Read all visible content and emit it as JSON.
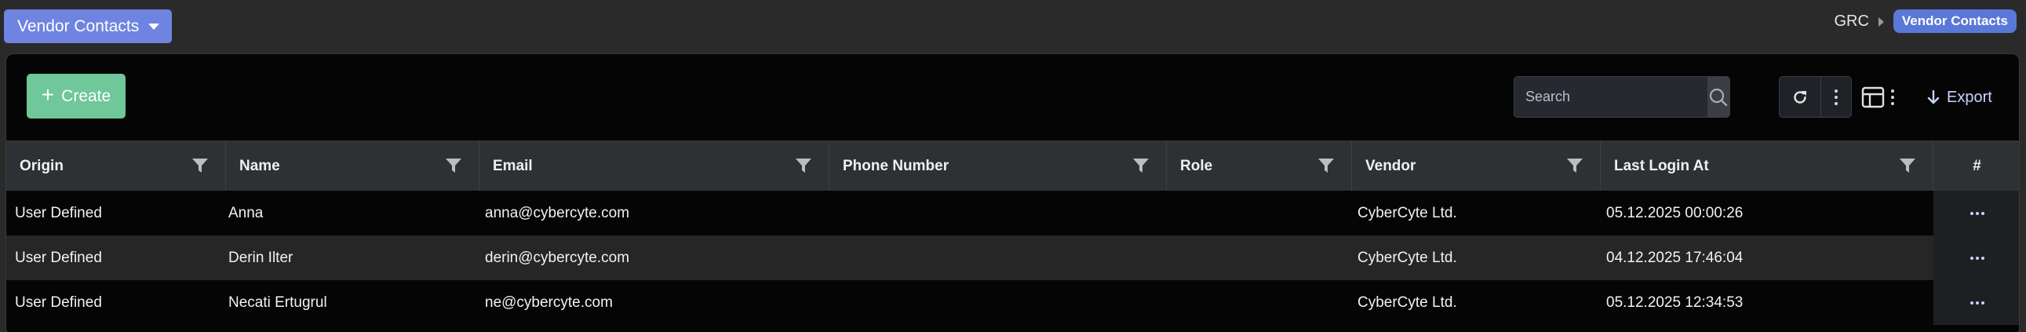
{
  "header": {
    "module_select_label": "Vendor Contacts",
    "breadcrumb": {
      "root": "GRC",
      "current": "Vendor Contacts"
    }
  },
  "toolbar": {
    "create_label": "Create",
    "search_placeholder": "Search",
    "export_label": "Export"
  },
  "table": {
    "columns": [
      "Origin",
      "Name",
      "Email",
      "Phone Number",
      "Role",
      "Vendor",
      "Last Login At",
      "#"
    ],
    "rows": [
      {
        "origin": "User Defined",
        "name": "Anna",
        "email": "anna@cybercyte.com",
        "phone": "",
        "role": "",
        "vendor": "CyberCyte Ltd.",
        "last_login": "05.12.2025 00:00:26"
      },
      {
        "origin": "User Defined",
        "name": "Derin Ilter",
        "email": "derin@cybercyte.com",
        "phone": "",
        "role": "",
        "vendor": "CyberCyte Ltd.",
        "last_login": "04.12.2025 17:46:04"
      },
      {
        "origin": "User Defined",
        "name": "Necati Ertugrul",
        "email": "ne@cybercyte.com",
        "phone": "",
        "role": "",
        "vendor": "CyberCyte Ltd.",
        "last_login": "05.12.2025 12:34:53"
      }
    ]
  },
  "colors": {
    "module_select": "#6f84e0",
    "breadcrumb_badge": "#5a78d8",
    "create_button": "#6fc79a",
    "export_text": "#c9d3ff"
  }
}
